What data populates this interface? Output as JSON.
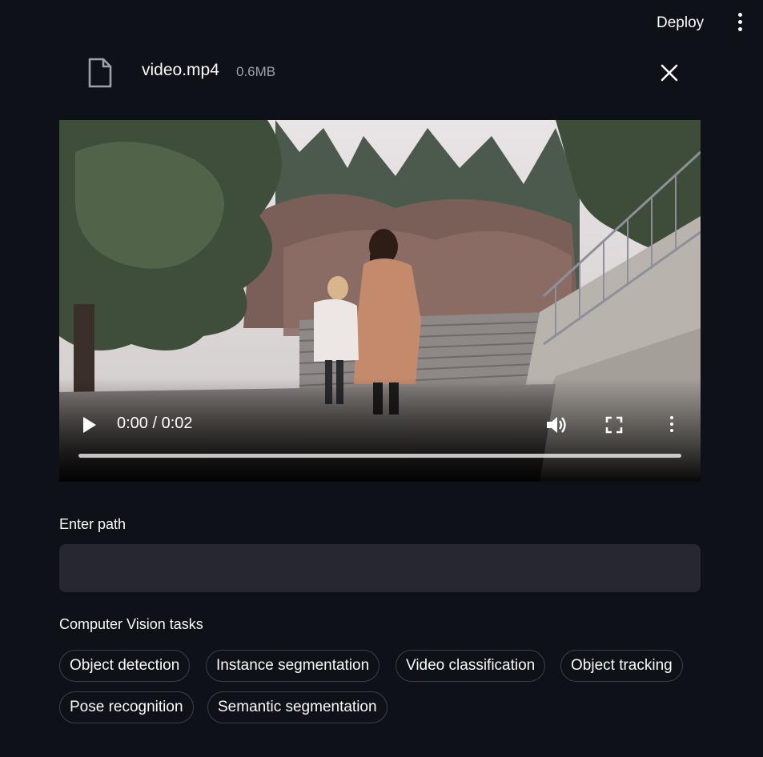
{
  "header": {
    "deploy_label": "Deploy",
    "menu_icon": "kebab-menu-icon"
  },
  "file": {
    "icon": "file-icon",
    "name": "video.mp4",
    "size": "0.6MB",
    "remove_icon": "close-icon"
  },
  "video": {
    "time": "0:00 / 0:02",
    "progress": 0,
    "play_icon": "play-icon",
    "volume_icon": "volume-icon",
    "fullscreen_icon": "fullscreen-icon",
    "more_icon": "more-options-icon"
  },
  "path_input": {
    "label": "Enter path",
    "value": "",
    "placeholder": ""
  },
  "tasks": {
    "label": "Computer Vision tasks",
    "options": [
      "Object detection",
      "Instance segmentation",
      "Video classification",
      "Object tracking",
      "Pose recognition",
      "Semantic segmentation"
    ]
  }
}
